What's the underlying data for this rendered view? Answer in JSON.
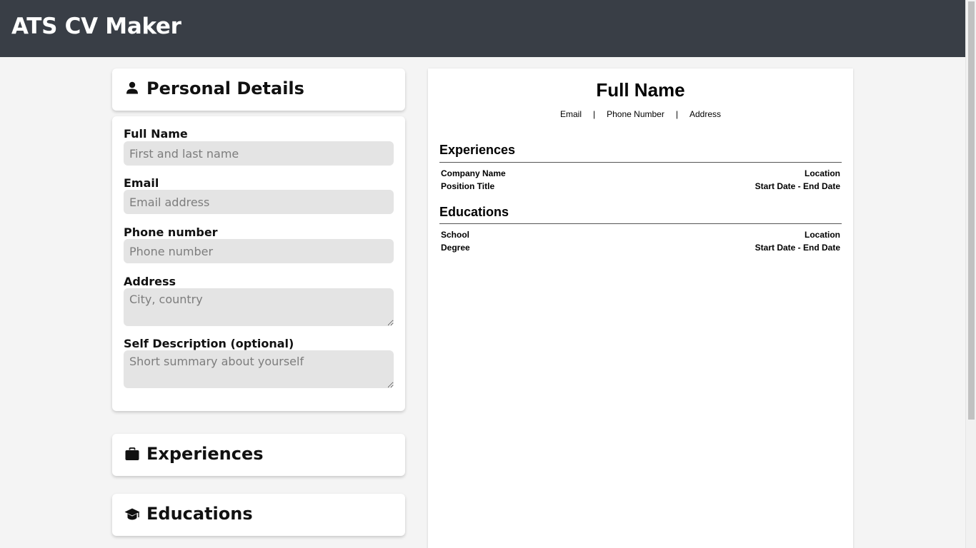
{
  "app": {
    "title": "ATS CV Maker"
  },
  "sections": {
    "personal": {
      "title": "Personal Details",
      "icon": "person-icon"
    },
    "experiences": {
      "title": "Experiences",
      "icon": "briefcase-icon"
    },
    "educations": {
      "title": "Educations",
      "icon": "graduation-cap-icon"
    }
  },
  "form": {
    "full_name": {
      "label": "Full Name",
      "placeholder": "First and last name",
      "value": ""
    },
    "email": {
      "label": "Email",
      "placeholder": "Email address",
      "value": ""
    },
    "phone": {
      "label": "Phone number",
      "placeholder": "Phone number",
      "value": ""
    },
    "address": {
      "label": "Address",
      "placeholder": "City, country",
      "value": ""
    },
    "description": {
      "label": "Self Description (optional)",
      "placeholder": "Short summary about yourself",
      "value": ""
    }
  },
  "preview": {
    "name": "Full Name",
    "contact": {
      "email": "Email",
      "phone": "Phone Number",
      "address": "Address",
      "separator": "|"
    },
    "experiences": {
      "title": "Experiences",
      "company": "Company Name",
      "location": "Location",
      "position": "Position Title",
      "dates": "Start Date - End Date"
    },
    "educations": {
      "title": "Educations",
      "school": "School",
      "location": "Location",
      "degree": "Degree",
      "dates": "Start Date - End Date"
    }
  },
  "colors": {
    "header_bg": "#393e46",
    "page_bg": "#f4f4f4",
    "input_bg": "#e4e4e4"
  }
}
